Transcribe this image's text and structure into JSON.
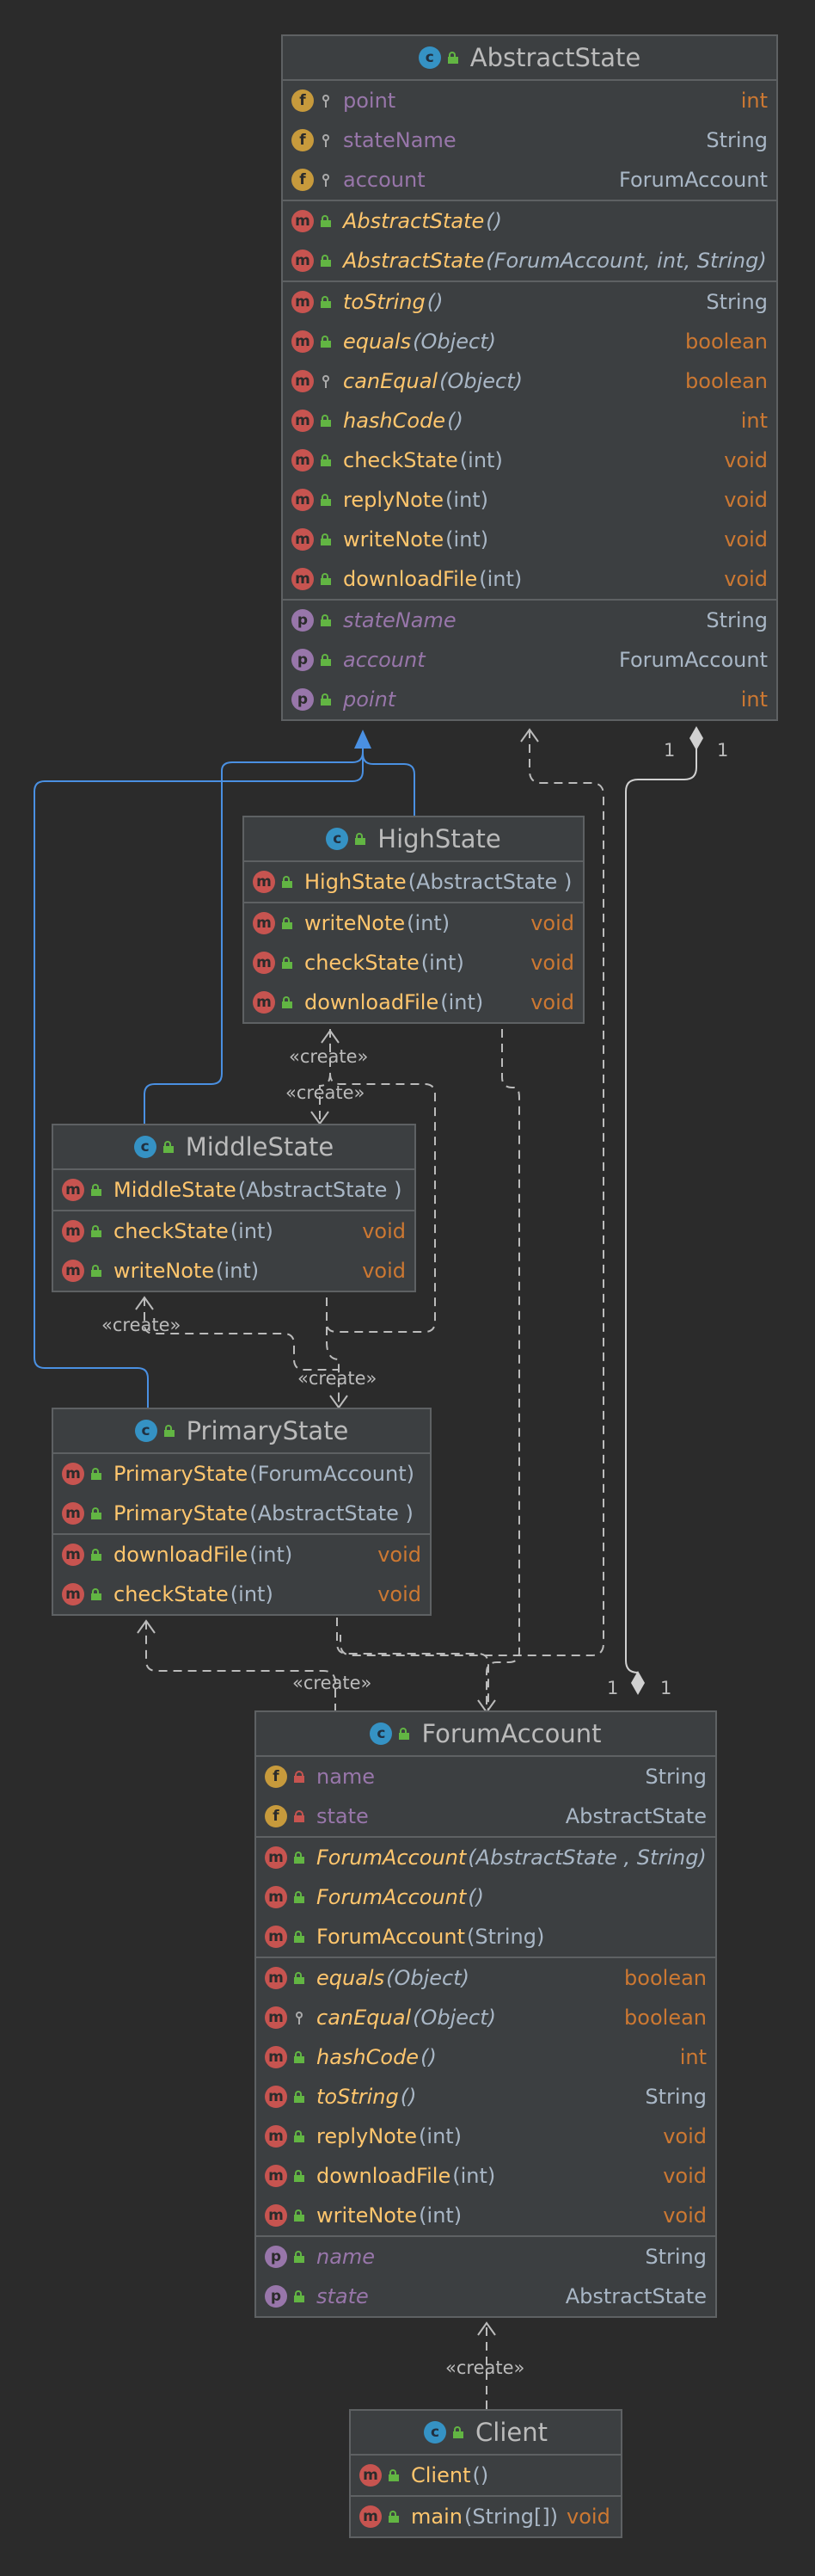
{
  "colors": {
    "background": "#2b2b2b",
    "box": "#3c3f41",
    "border": "#5e6163",
    "method": "#ffc66d",
    "field": "#9876aa",
    "keyword": "#cc7832",
    "text": "#a9b7c6",
    "inheritance": "#4a90e2",
    "dependency": "#bbbbbb"
  },
  "classes": {
    "abstractState": {
      "name": "AbstractState",
      "icon": "abstract-class-icon",
      "fields": [
        {
          "name": "point",
          "type": "int"
        },
        {
          "name": "stateName",
          "type": "String"
        },
        {
          "name": "account",
          "type": "ForumAccount"
        }
      ],
      "constructors": [
        {
          "name": "AbstractState",
          "args": "()"
        },
        {
          "name": "AbstractState",
          "args": "(ForumAccount, int, String)"
        }
      ],
      "methods": [
        {
          "name": "toString",
          "args": "()",
          "type": "String"
        },
        {
          "name": "equals",
          "args": "(Object)",
          "type": "boolean"
        },
        {
          "name": "canEqual",
          "args": "(Object)",
          "type": "boolean"
        },
        {
          "name": "hashCode",
          "args": "()",
          "type": "int"
        },
        {
          "name": "checkState",
          "args": "(int)",
          "type": "void"
        },
        {
          "name": "replyNote",
          "args": "(int)",
          "type": "void"
        },
        {
          "name": "writeNote",
          "args": "(int)",
          "type": "void"
        },
        {
          "name": "downloadFile",
          "args": "(int)",
          "type": "void"
        }
      ],
      "properties": [
        {
          "name": "stateName",
          "type": "String"
        },
        {
          "name": "account",
          "type": "ForumAccount"
        },
        {
          "name": "point",
          "type": "int"
        }
      ]
    },
    "highState": {
      "name": "HighState",
      "icon": "class-icon",
      "constructors": [
        {
          "name": "HighState",
          "args": "(AbstractState )"
        }
      ],
      "methods": [
        {
          "name": "writeNote",
          "args": "(int)",
          "type": "void"
        },
        {
          "name": "checkState",
          "args": "(int)",
          "type": "void"
        },
        {
          "name": "downloadFile",
          "args": "(int)",
          "type": "void"
        }
      ]
    },
    "middleState": {
      "name": "MiddleState",
      "icon": "class-icon",
      "constructors": [
        {
          "name": "MiddleState",
          "args": "(AbstractState )"
        }
      ],
      "methods": [
        {
          "name": "checkState",
          "args": "(int)",
          "type": "void"
        },
        {
          "name": "writeNote",
          "args": "(int)",
          "type": "void"
        }
      ]
    },
    "primaryState": {
      "name": "PrimaryState",
      "icon": "class-icon",
      "constructors": [
        {
          "name": "PrimaryState",
          "args": "(ForumAccount)"
        },
        {
          "name": "PrimaryState",
          "args": "(AbstractState )"
        }
      ],
      "methods": [
        {
          "name": "downloadFile",
          "args": "(int)",
          "type": "void"
        },
        {
          "name": "checkState",
          "args": "(int)",
          "type": "void"
        }
      ]
    },
    "forumAccount": {
      "name": "ForumAccount",
      "icon": "class-icon",
      "fields": [
        {
          "name": "name",
          "type": "String"
        },
        {
          "name": "state",
          "type": "AbstractState"
        }
      ],
      "constructors": [
        {
          "name": "ForumAccount",
          "args": "(AbstractState , String)"
        },
        {
          "name": "ForumAccount",
          "args": "()"
        },
        {
          "name": "ForumAccount",
          "args": "(String)"
        }
      ],
      "methods": [
        {
          "name": "equals",
          "args": "(Object)",
          "type": "boolean"
        },
        {
          "name": "canEqual",
          "args": "(Object)",
          "type": "boolean"
        },
        {
          "name": "hashCode",
          "args": "()",
          "type": "int"
        },
        {
          "name": "toString",
          "args": "()",
          "type": "String"
        },
        {
          "name": "replyNote",
          "args": "(int)",
          "type": "void"
        },
        {
          "name": "downloadFile",
          "args": "(int)",
          "type": "void"
        },
        {
          "name": "writeNote",
          "args": "(int)",
          "type": "void"
        }
      ],
      "properties": [
        {
          "name": "name",
          "type": "String"
        },
        {
          "name": "state",
          "type": "AbstractState"
        }
      ]
    },
    "client": {
      "name": "Client",
      "icon": "main-class-icon",
      "constructors": [
        {
          "name": "Client",
          "args": "()"
        }
      ],
      "methods": [
        {
          "name": "main",
          "args": "(String[])",
          "type": "void"
        }
      ]
    }
  },
  "edge_labels": {
    "create": "«create»",
    "multiplicity_one": "1"
  }
}
